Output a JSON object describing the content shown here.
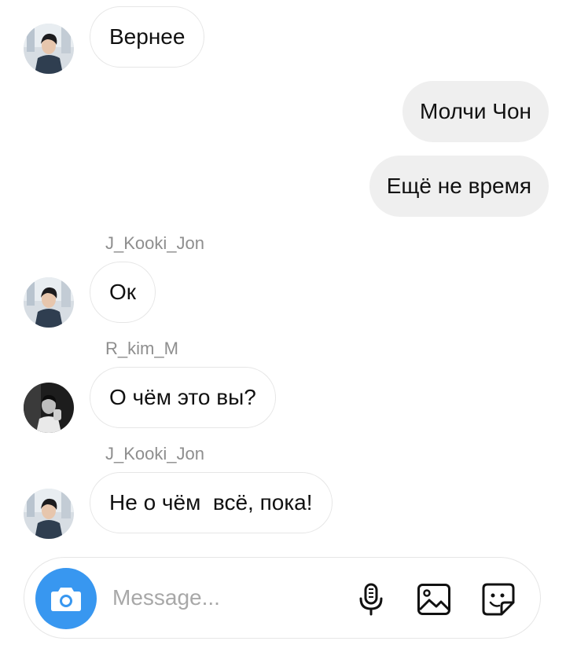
{
  "messages": [
    {
      "type": "incoming",
      "text": "Вернее",
      "avatar": "jungkook-avatar"
    },
    {
      "type": "outgoing",
      "text": "Молчи Чон"
    },
    {
      "type": "outgoing",
      "text": "Ещё не время"
    },
    {
      "type": "incoming",
      "sender": "J_Kooki_Jon",
      "text": "Ок",
      "avatar": "jungkook-avatar"
    },
    {
      "type": "incoming",
      "sender": "R_kim_M",
      "text": "О чём это вы?",
      "avatar": "rm-avatar"
    },
    {
      "type": "incoming",
      "sender": "J_Kooki_Jon",
      "text": "Не о чём  всё, пока!",
      "avatar": "jungkook-avatar"
    }
  ],
  "composer": {
    "placeholder": "Message...",
    "icons": [
      "camera-icon",
      "microphone-icon",
      "gallery-icon",
      "sticker-icon"
    ]
  },
  "colors": {
    "accent": "#3897f0",
    "outgoing_bubble": "#efefef",
    "incoming_border": "#e6e6e6",
    "sender_text": "#8e8e8e",
    "placeholder": "#a8a8a8"
  }
}
